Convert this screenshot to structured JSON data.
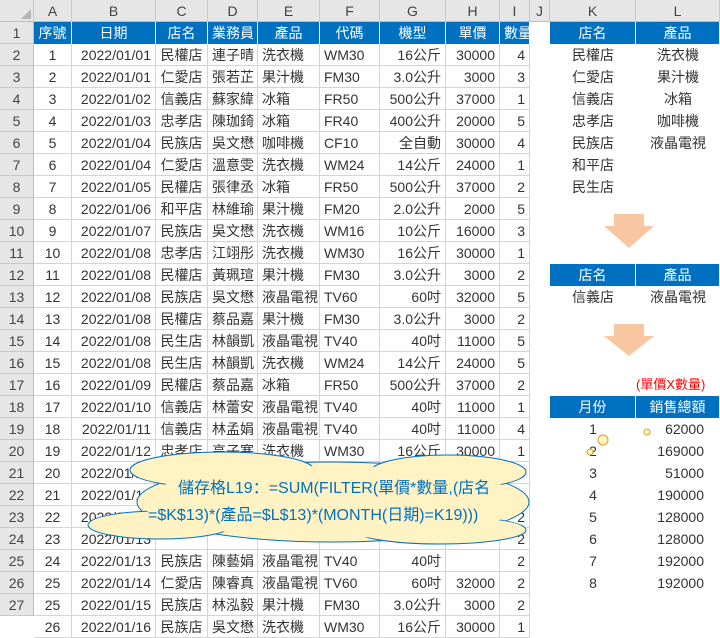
{
  "columns": [
    "A",
    "B",
    "C",
    "D",
    "E",
    "F",
    "G",
    "H",
    "I",
    "J",
    "K",
    "L"
  ],
  "row_numbers": [
    "1",
    "2",
    "3",
    "4",
    "5",
    "6",
    "7",
    "8",
    "9",
    "10",
    "11",
    "12",
    "13",
    "14",
    "15",
    "16",
    "17",
    "18",
    "19",
    "20",
    "21",
    "22",
    "23",
    "24",
    "25",
    "26",
    "27"
  ],
  "main_table": {
    "headers": [
      "序號",
      "日期",
      "店名",
      "業務員",
      "產品",
      "代碼",
      "機型",
      "單價",
      "數量"
    ],
    "rows": [
      [
        "1",
        "2022/01/01",
        "民權店",
        "連子晴",
        "洗衣機",
        "WM30",
        "16公斤",
        "30000",
        "4"
      ],
      [
        "2",
        "2022/01/01",
        "仁愛店",
        "張若芷",
        "果汁機",
        "FM30",
        "3.0公升",
        "3000",
        "3"
      ],
      [
        "3",
        "2022/01/02",
        "信義店",
        "蘇家緯",
        "冰箱",
        "FR50",
        "500公升",
        "37000",
        "1"
      ],
      [
        "4",
        "2022/01/03",
        "忠孝店",
        "陳珈錡",
        "冰箱",
        "FR40",
        "400公升",
        "20000",
        "5"
      ],
      [
        "5",
        "2022/01/04",
        "民族店",
        "吳文懋",
        "咖啡機",
        "CF10",
        "全自動",
        "30000",
        "4"
      ],
      [
        "6",
        "2022/01/04",
        "仁愛店",
        "溫意雯",
        "洗衣機",
        "WM24",
        "14公斤",
        "24000",
        "1"
      ],
      [
        "7",
        "2022/01/05",
        "民權店",
        "張律丞",
        "冰箱",
        "FR50",
        "500公升",
        "37000",
        "2"
      ],
      [
        "8",
        "2022/01/06",
        "和平店",
        "林維瑜",
        "果汁機",
        "FM20",
        "2.0公升",
        "2000",
        "5"
      ],
      [
        "9",
        "2022/01/07",
        "民族店",
        "吳文懋",
        "洗衣機",
        "WM16",
        "10公斤",
        "16000",
        "3"
      ],
      [
        "10",
        "2022/01/08",
        "忠孝店",
        "江翊彤",
        "洗衣機",
        "WM30",
        "16公斤",
        "30000",
        "1"
      ],
      [
        "11",
        "2022/01/08",
        "民權店",
        "黃珮瑄",
        "果汁機",
        "FM30",
        "3.0公升",
        "3000",
        "2"
      ],
      [
        "12",
        "2022/01/08",
        "民族店",
        "吳文懋",
        "液晶電視",
        "TV60",
        "60吋",
        "32000",
        "5"
      ],
      [
        "13",
        "2022/01/08",
        "民權店",
        "蔡品嘉",
        "果汁機",
        "FM30",
        "3.0公升",
        "3000",
        "2"
      ],
      [
        "14",
        "2022/01/08",
        "民生店",
        "林韻凱",
        "液晶電視",
        "TV40",
        "40吋",
        "11000",
        "5"
      ],
      [
        "15",
        "2022/01/08",
        "民生店",
        "林韻凱",
        "洗衣機",
        "WM24",
        "14公斤",
        "24000",
        "5"
      ],
      [
        "16",
        "2022/01/09",
        "民權店",
        "蔡品嘉",
        "冰箱",
        "FR50",
        "500公升",
        "37000",
        "2"
      ],
      [
        "17",
        "2022/01/10",
        "信義店",
        "林蕾安",
        "液晶電視",
        "TV40",
        "40吋",
        "11000",
        "1"
      ],
      [
        "18",
        "2022/01/11",
        "信義店",
        "林孟娟",
        "液晶電視",
        "TV40",
        "40吋",
        "11000",
        "4"
      ],
      [
        "19",
        "2022/01/12",
        "忠孝店",
        "高子寒",
        "洗衣機",
        "WM30",
        "16公斤",
        "30000",
        "1"
      ],
      [
        "20",
        "2022/01/12",
        "",
        "",
        "",
        "",
        "",
        "",
        "3"
      ],
      [
        "21",
        "2022/01/12",
        "",
        "",
        "",
        "",
        "",
        "",
        "1"
      ],
      [
        "22",
        "2022/01/13",
        "",
        "",
        "",
        "",
        "",
        "",
        "2"
      ],
      [
        "23",
        "2022/01/13",
        "",
        "",
        "",
        "",
        "",
        "",
        "2"
      ],
      [
        "24",
        "2022/01/13",
        "民族店",
        "陳藝娟",
        "液晶電視",
        "TV40",
        "40吋",
        "",
        "2"
      ],
      [
        "25",
        "2022/01/14",
        "仁愛店",
        "陳睿真",
        "液晶電視",
        "TV60",
        "60吋",
        "32000",
        "2"
      ],
      [
        "25",
        "2022/01/15",
        "民族店",
        "林泓毅",
        "果汁機",
        "FM30",
        "3.0公升",
        "3000",
        "2"
      ],
      [
        "26",
        "2022/01/16",
        "民族店",
        "吳文懋",
        "洗衣機",
        "WM30",
        "16公斤",
        "30000",
        "1"
      ]
    ]
  },
  "lookup_table": {
    "headers": [
      "店名",
      "產品"
    ],
    "stores": [
      "民權店",
      "仁愛店",
      "信義店",
      "忠孝店",
      "民族店",
      "和平店",
      "民生店"
    ],
    "products": [
      "洗衣機",
      "果汁機",
      "冰箱",
      "咖啡機",
      "液晶電視"
    ]
  },
  "criteria_table": {
    "headers": [
      "店名",
      "產品"
    ],
    "store": "信義店",
    "product": "液晶電視"
  },
  "note": "(單價X數量)",
  "summary_table": {
    "headers": [
      "月份",
      "銷售總額"
    ],
    "months": [
      "1",
      "2",
      "3",
      "4",
      "5",
      "6",
      "7",
      "8"
    ],
    "totals": [
      "62000",
      "169000",
      "51000",
      "190000",
      "128000",
      "128000",
      "192000",
      "192000"
    ]
  },
  "callout": {
    "line1": "儲存格L19：=SUM(FILTER(單價*數量,(店名",
    "line2": "=$K$13)*(產品=$L$13)*(MONTH(日期)=K19)))"
  },
  "colors": {
    "header_blue": "#0070c0",
    "arrow": "#f8c6a0",
    "callout_fill": "#fff3c4",
    "callout_text": "#0070c0",
    "note_red": "#ff0000"
  }
}
